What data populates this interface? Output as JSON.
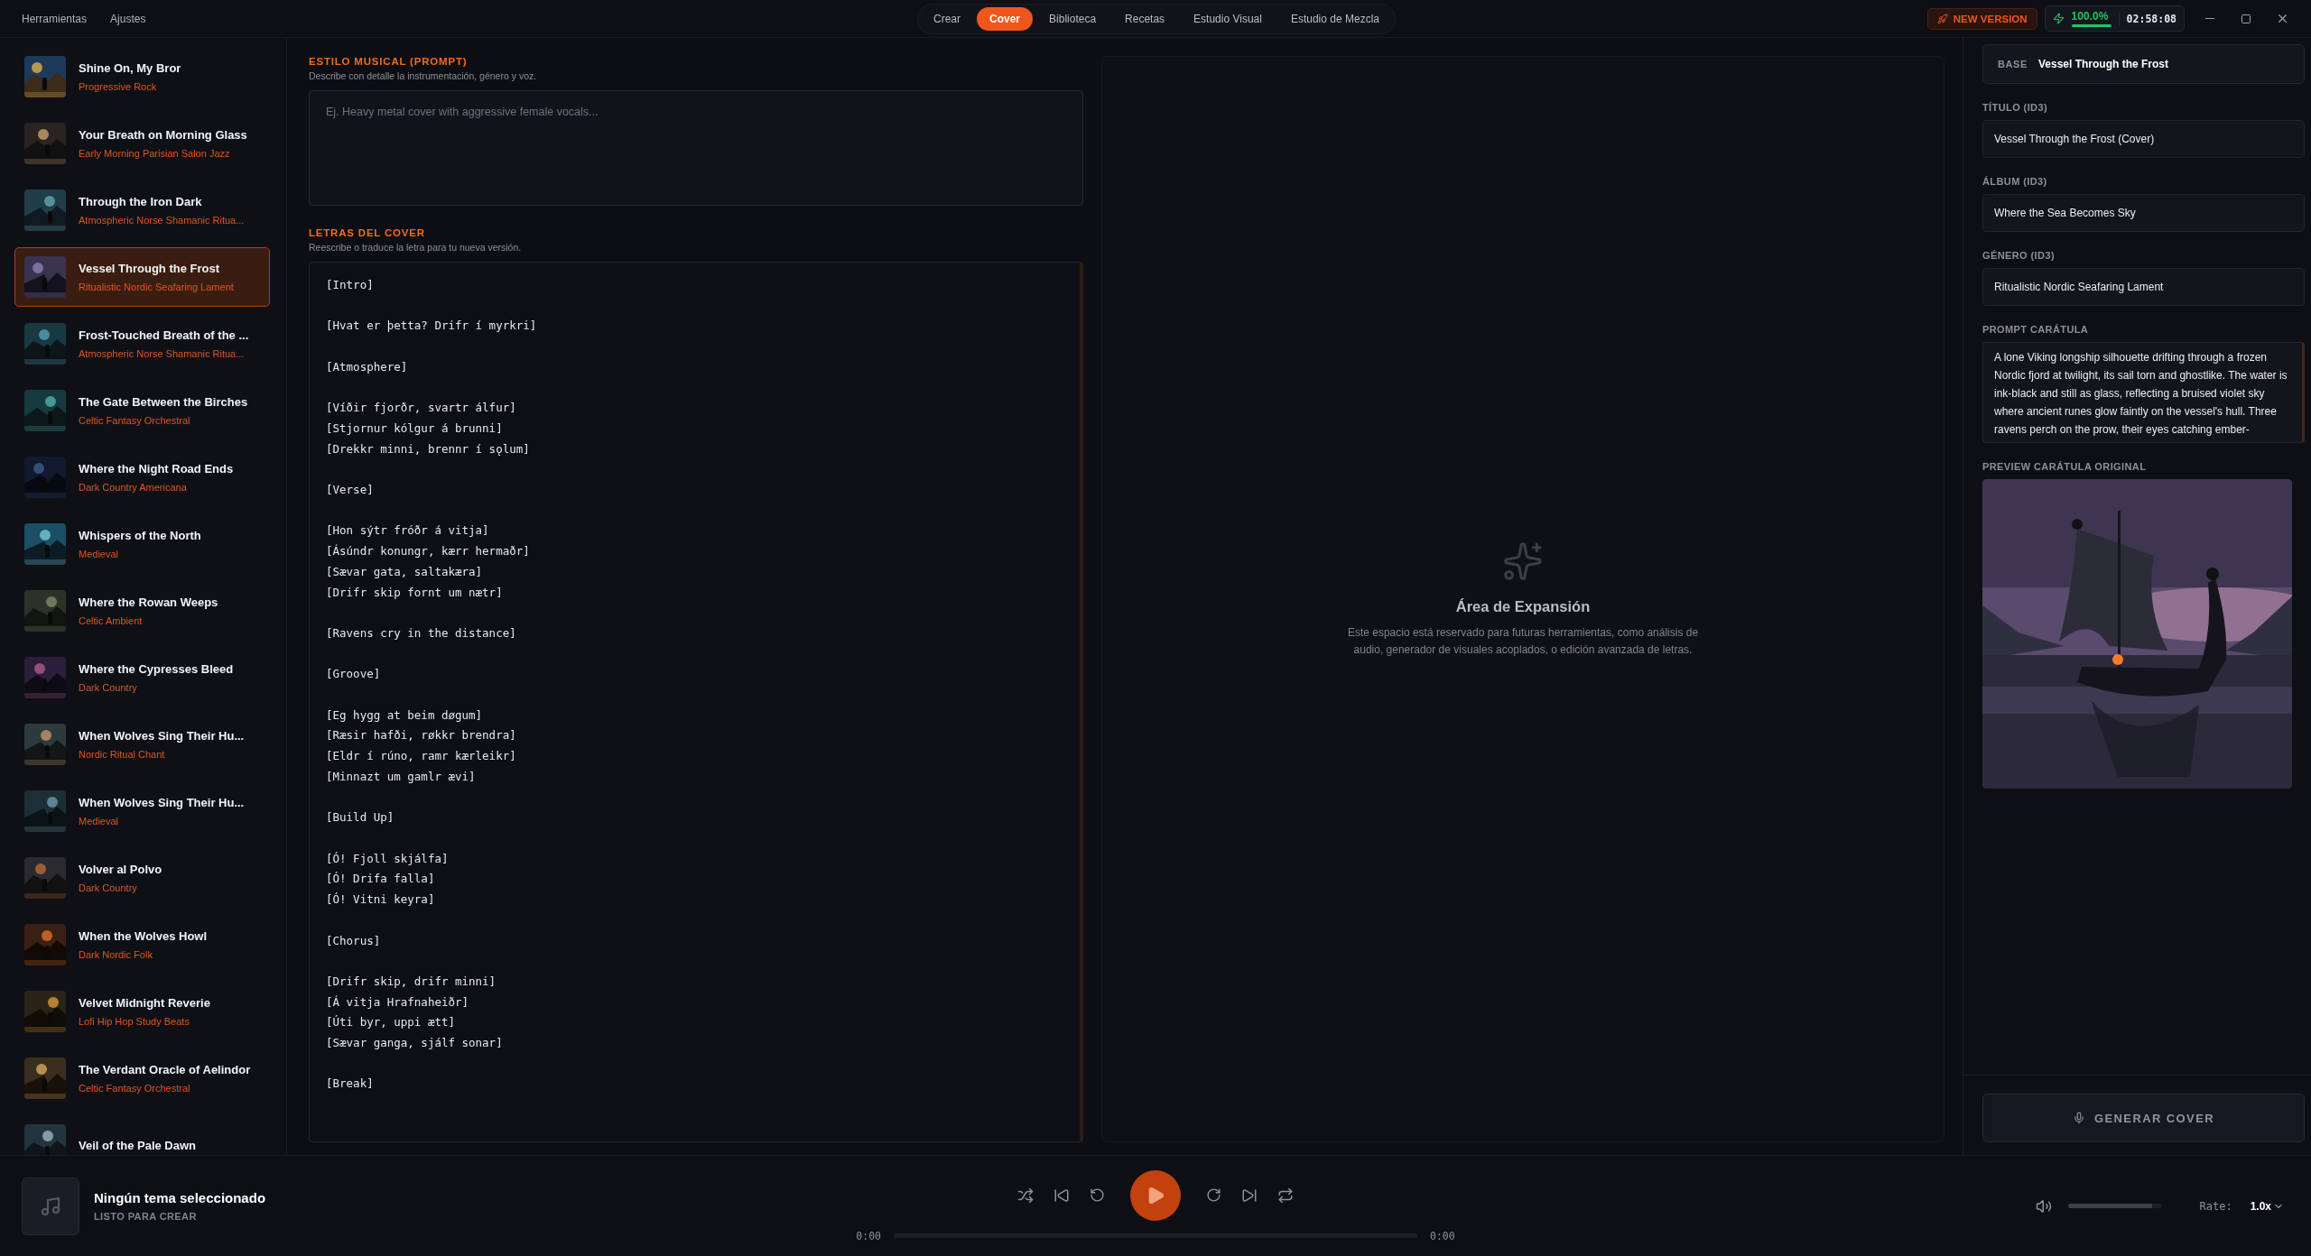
{
  "menu": [
    {
      "label": "Herramientas"
    },
    {
      "label": "Ajustes"
    }
  ],
  "tabs": [
    {
      "label": "Crear",
      "selected": false
    },
    {
      "label": "Cover",
      "selected": true
    },
    {
      "label": "Biblioteca",
      "selected": false
    },
    {
      "label": "Recetas",
      "selected": false
    },
    {
      "label": "Estudio Visual",
      "selected": false
    },
    {
      "label": "Estudio de Mezcla",
      "selected": false
    }
  ],
  "badge": {
    "label": "NEW VERSION"
  },
  "status": {
    "percent": "100.0%",
    "level": 1,
    "time": "02:58:08"
  },
  "library": [
    {
      "title": "Shine On, My Bror",
      "genre": "Progressive Rock",
      "selected": false
    },
    {
      "title": "Your Breath on Morning Glass",
      "genre": "Early Morning Parisian Salon Jazz",
      "selected": false
    },
    {
      "title": "Through the Iron Dark",
      "genre": "Atmospheric Norse Shamanic Ritua...",
      "selected": false
    },
    {
      "title": "Vessel Through the Frost",
      "genre": "Ritualistic Nordic Seafaring Lament",
      "selected": true
    },
    {
      "title": "Frost-Touched Breath of the ...",
      "genre": "Atmospheric Norse Shamanic Ritua...",
      "selected": false
    },
    {
      "title": "The Gate Between the Birches",
      "genre": "Celtic Fantasy Orchestral",
      "selected": false
    },
    {
      "title": "Where the Night Road Ends",
      "genre": "Dark Country Americana",
      "selected": false
    },
    {
      "title": "Whispers of the North",
      "genre": "Medieval",
      "selected": false
    },
    {
      "title": "Where the Rowan Weeps",
      "genre": "Celtic Ambient",
      "selected": false
    },
    {
      "title": "Where the Cypresses Bleed",
      "genre": "Dark Country",
      "selected": false
    },
    {
      "title": "When Wolves Sing Their Hu...",
      "genre": "Nordic Ritual Chant",
      "selected": false
    },
    {
      "title": "When Wolves Sing Their Hu...",
      "genre": "Medieval",
      "selected": false
    },
    {
      "title": "Volver al Polvo",
      "genre": "Dark Country",
      "selected": false
    },
    {
      "title": "When the Wolves Howl",
      "genre": "Dark Nordic Folk",
      "selected": false
    },
    {
      "title": "Velvet Midnight Reverie",
      "genre": "Lofi Hip Hop Study Beats",
      "selected": false
    },
    {
      "title": "The Verdant Oracle of Aelindor",
      "genre": "Celtic Fantasy Orchestral",
      "selected": false
    },
    {
      "title": "Veil of the Pale Dawn",
      "selected": false
    }
  ],
  "style_prompt": {
    "heading": "ESTILO MUSICAL (PROMPT)",
    "hint": "Describe con detalle la instrumentación, género y voz.",
    "placeholder": "Ej. Heavy metal cover with aggressive female vocals..."
  },
  "lyrics": {
    "heading": "LETRAS DEL COVER",
    "hint": "Reescribe o traduce la letra para tu nueva versión.",
    "value": "[Intro]\n\n[Hvat er þetta? Drifr í myrkri]\n\n[Atmosphere]\n\n[Víðir fjorðr, svartr álfur]\n[Stjornur kólgur á brunni]\n[Drekkr minni, brennr í sǫlum]\n\n[Verse]\n\n[Hon sýtr fróðr á vitja]\n[Ásúndr konungr, kærr hermaðr]\n[Sævar gata, saltakæra]\n[Drifr skip fornt um nætr]\n\n[Ravens cry in the distance]\n\n[Groove]\n\n[Eg hygg at beim døgum]\n[Ræsir hafði, røkkr brendra]\n[Eldr í rúno, ramr kærleikr]\n[Minnazt um gamlr ævi]\n\n[Build Up]\n\n[Ó! Fjoll skjálfa]\n[Ó! Drifa falla]\n[Ó! Vitni keyra]\n\n[Chorus]\n\n[Drifr skip, drifr minni]\n[Á vitja Hrafnaheiðr]\n[Úti byr, uppi ætt]\n[Sævar ganga, sjálf sonar]\n\n[Break]"
  },
  "expansion": {
    "title": "Área de Expansión",
    "text": "Este espacio está reservado para futuras herramientas, como análisis de audio, generador de visuales acoplados, o edición avanzada de letras."
  },
  "details": {
    "base_label": "BASE",
    "base_value": "Vessel Through the Frost",
    "fields": [
      {
        "label": "TÍTULO (ID3)",
        "value": "Vessel Through the Frost (Cover)"
      },
      {
        "label": "ÁLBUM (ID3)",
        "value": "Where the Sea Becomes Sky"
      },
      {
        "label": "GÉNERO (ID3)",
        "value": "Ritualistic Nordic Seafaring Lament"
      }
    ],
    "cover_prompt": {
      "label": "PROMPT CARÁTULA",
      "value": "A lone Viking longship silhouette drifting through a frozen Nordic fjord at twilight, its sail torn and ghostlike. The water is ink-black and still as glass, reflecting a bruised violet sky where ancient runes glow faintly on the vessel's hull. Three ravens perch on the prow, their eyes catching ember-"
    },
    "preview_label": "PREVIEW CARÁTULA ORIGINAL",
    "button": "GENERAR COVER"
  },
  "player": {
    "title": "Ningún tema seleccionado",
    "status": "LISTO PARA CREAR",
    "elapsed": "0:00",
    "total": "0:00",
    "volume": {
      "level": 0.9
    },
    "rate_label": "Rate:",
    "rate": "1.0x"
  }
}
